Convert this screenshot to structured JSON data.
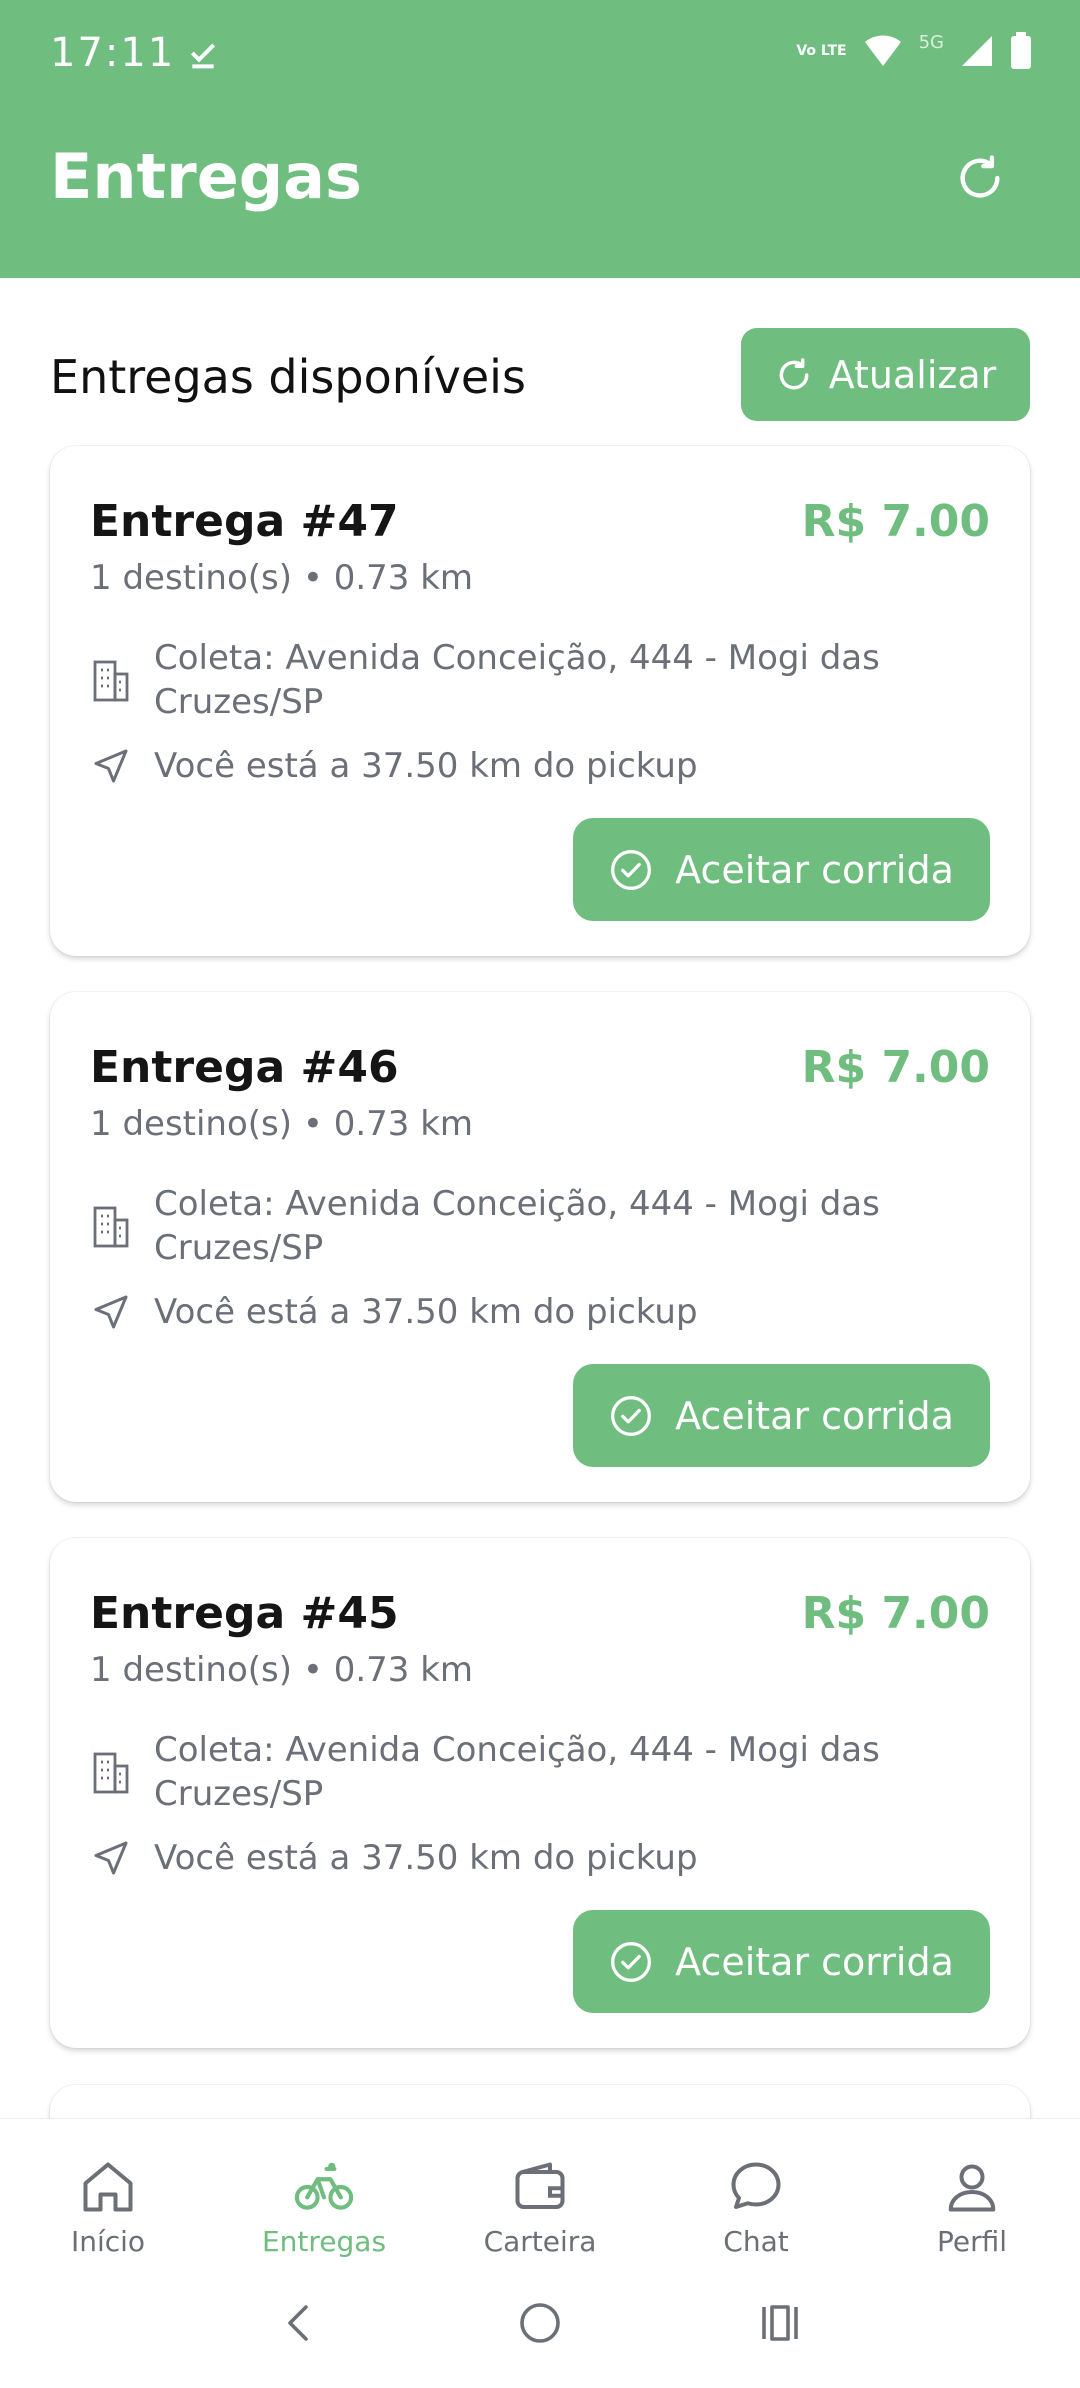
{
  "status_bar": {
    "time": "17:11",
    "network": "5G",
    "volte": "Vo LTE"
  },
  "header": {
    "title": "Entregas"
  },
  "section": {
    "title": "Entregas disponíveis",
    "update_label": "Atualizar"
  },
  "cards": [
    {
      "title": "Entrega #47",
      "price": "R$ 7.00",
      "subtitle": "1 destino(s) • 0.73 km",
      "address": "Coleta: Avenida Conceição, 444 - Mogi das Cruzes/SP",
      "distance": "Você está a 37.50 km do pickup",
      "accept_label": "Aceitar corrida"
    },
    {
      "title": "Entrega #46",
      "price": "R$ 7.00",
      "subtitle": "1 destino(s) • 0.73 km",
      "address": "Coleta: Avenida Conceição, 444 - Mogi das Cruzes/SP",
      "distance": "Você está a 37.50 km do pickup",
      "accept_label": "Aceitar corrida"
    },
    {
      "title": "Entrega #45",
      "price": "R$ 7.00",
      "subtitle": "1 destino(s) • 0.73 km",
      "address": "Coleta: Avenida Conceição, 444 - Mogi das Cruzes/SP",
      "distance": "Você está a 37.50 km do pickup",
      "accept_label": "Aceitar corrida"
    }
  ],
  "bottom_nav": {
    "items": [
      {
        "label": "Início",
        "icon": "home-icon"
      },
      {
        "label": "Entregas",
        "icon": "bicycle-icon",
        "active": true
      },
      {
        "label": "Carteira",
        "icon": "wallet-icon"
      },
      {
        "label": "Chat",
        "icon": "chat-icon"
      },
      {
        "label": "Perfil",
        "icon": "user-icon"
      }
    ]
  },
  "colors": {
    "primary": "#6fbd7f",
    "text": "#151515",
    "muted": "#6a6f78"
  }
}
